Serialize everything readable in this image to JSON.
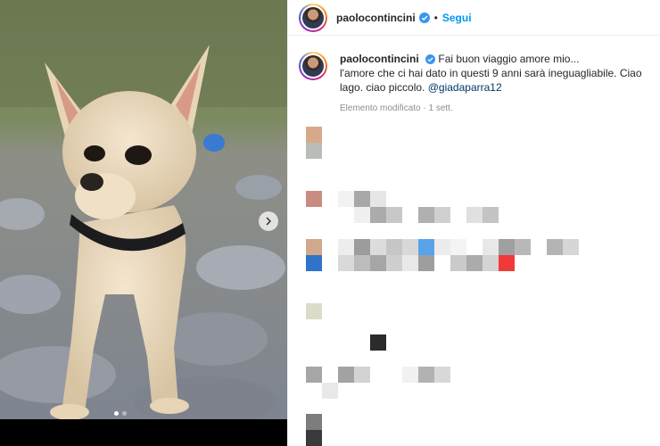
{
  "post": {
    "username": "paolocontincini",
    "follow_label": "Segui",
    "separator": "•",
    "caption": {
      "username": "paolocontincini",
      "text_line1": "Fai buon viaggio amore mio...",
      "text_line2": "l'amore che ci hai dato in questi 9 anni sarà ineguagliabile. Ciao lago. ciao piccolo. ",
      "mention": "@giadaparra12",
      "meta": "Elemento modificato · 1 sett."
    },
    "carousel": {
      "current_index": 1,
      "total": 2
    }
  },
  "colors": {
    "accent": "#0095f6",
    "verified": "#3897f0",
    "text": "#262626",
    "muted": "#8e8e8e"
  },
  "icons": {
    "verified": "verified-badge-icon",
    "next": "chevron-right-icon"
  }
}
